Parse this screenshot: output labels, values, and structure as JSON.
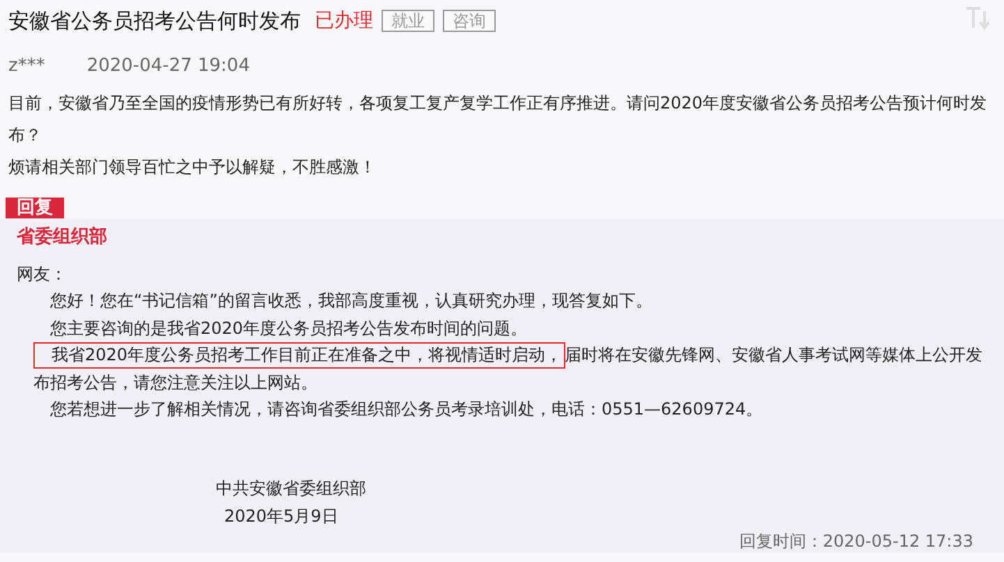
{
  "question": {
    "title": "安徽省公务员招考公告何时发布",
    "status": "已办理",
    "tags": [
      "就业",
      "咨询"
    ],
    "author": "z***",
    "time": "2020-04-27 19:04",
    "paragraphs": [
      "目前，安徽省乃至全国的疫情形势已有所好转，各项复工复产复学工作正有序推进。请问2020年度安徽省公务员招考公告预计何时发布？",
      "烦请相关部门领导百忙之中予以解疑，不胜感激！"
    ]
  },
  "reply": {
    "label": "回复",
    "department": "省委组织部",
    "greeting": "网友：",
    "paragraphs": [
      {
        "text": "您好！您在“书记信箱”的留言收悉，我部高度重视，认真研究办理，现答复如下。"
      },
      {
        "text": "您主要咨询的是我省2020年度公务员招考公告发布时间的问题。"
      },
      {
        "highlight": "我省2020年度公务员招考工作目前正在准备之中，将视情适时启动，",
        "text": "届时将在安徽先锋网、安徽省人事考试网等媒体上公开发布招考公告，请您注意关注以上网站。"
      },
      {
        "text": "您若想进一步了解相关情况，请咨询省委组织部公务员考录培训处，电话：0551—62609724。"
      }
    ],
    "signature": "中共安徽省委组织部",
    "date": "2020年5月9日",
    "reply_time": "回复时间：2020-05-12 17:33"
  }
}
